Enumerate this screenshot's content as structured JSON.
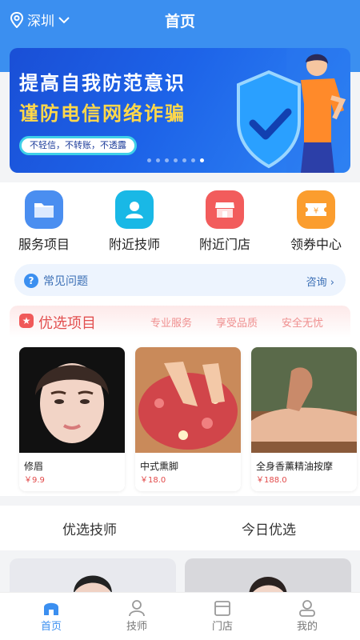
{
  "header": {
    "location": "深圳",
    "title": "首页"
  },
  "banner": {
    "headline1": "提高自我防范意识",
    "headline2": "谨防电信网络诈骗",
    "slogan": "不轻信，不转账，不透露",
    "slide_count": 7,
    "active_slide": 7
  },
  "quick": [
    {
      "label": "服务项目",
      "icon": "folder-icon",
      "color": "#4a8ef0"
    },
    {
      "label": "附近技师",
      "icon": "person-icon",
      "color": "#19b8e6"
    },
    {
      "label": "附近门店",
      "icon": "store-icon",
      "color": "#f25c5c"
    },
    {
      "label": "领券中心",
      "icon": "coupon-icon",
      "color": "#fb9d2e"
    }
  ],
  "faq": {
    "label": "常见问题",
    "link": "咨询 ›"
  },
  "selected": {
    "title": "优选项目",
    "tags": [
      "专业服务",
      "享受品质",
      "安全无忧"
    ],
    "items": [
      {
        "name": "修眉",
        "price": "￥9.9"
      },
      {
        "name": "中式熏脚",
        "price": "￥18.0"
      },
      {
        "name": "全身香薰精油按摩",
        "price": "￥188.0"
      }
    ]
  },
  "section_tabs": [
    "优选技师",
    "今日优选"
  ],
  "nav": [
    {
      "label": "首页",
      "icon": "home-icon",
      "active": true
    },
    {
      "label": "技师",
      "icon": "technician-icon",
      "active": false
    },
    {
      "label": "门店",
      "icon": "store-icon",
      "active": false
    },
    {
      "label": "我的",
      "icon": "user-icon",
      "active": false
    }
  ],
  "colors": {
    "primary": "#3b8ff0",
    "price": "#e24a4a",
    "accent_red": "#e25050"
  }
}
